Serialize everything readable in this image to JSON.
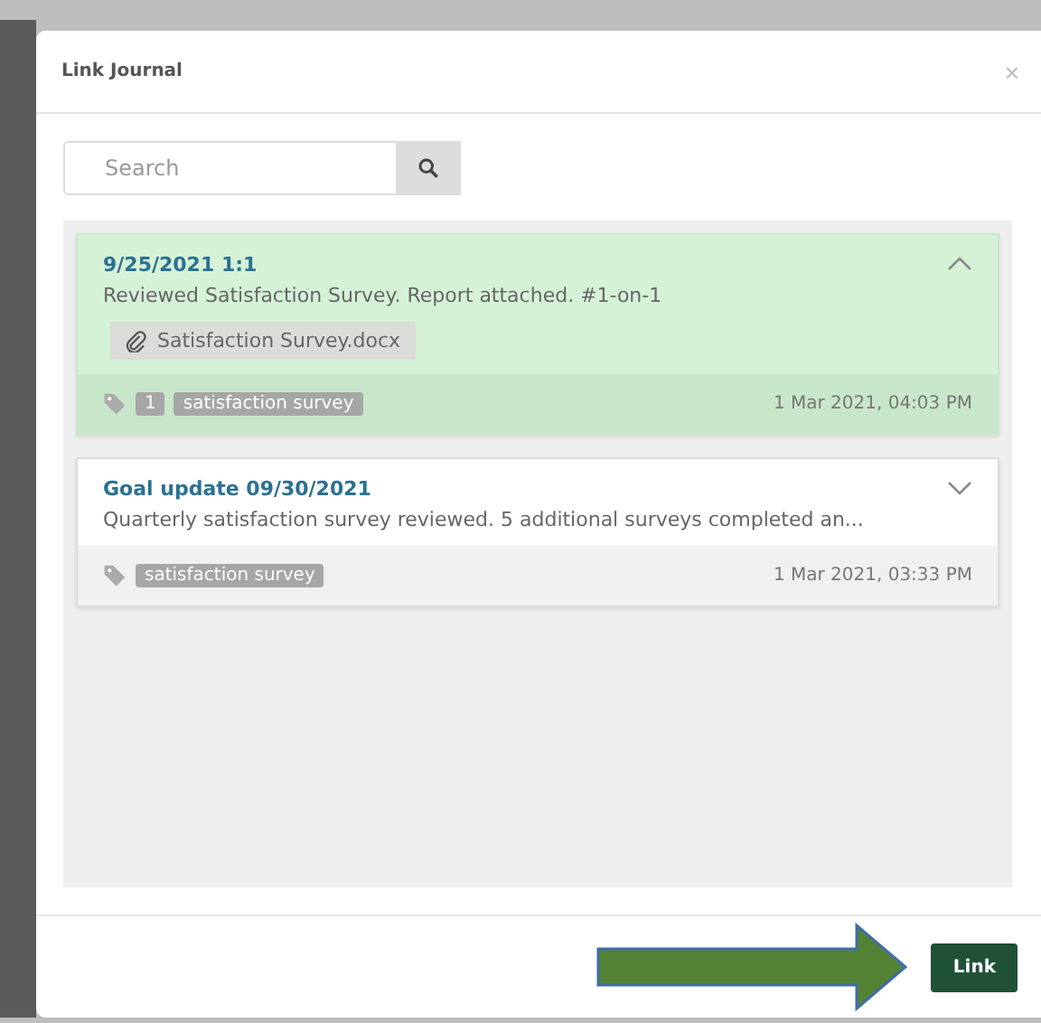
{
  "dialog": {
    "title": "Link Journal",
    "close_label": "×"
  },
  "search": {
    "placeholder": "Search"
  },
  "entries": [
    {
      "title": "9/25/2021 1:1",
      "text": "Reviewed Satisfaction Survey. Report attached. #1-on-1",
      "attachment": "Satisfaction Survey.docx",
      "tags": [
        "1",
        "satisfaction survey"
      ],
      "date": "1 Mar 2021, 04:03 PM",
      "selected": true,
      "expanded": true
    },
    {
      "title": "Goal update 09/30/2021",
      "text": "Quarterly satisfaction survey reviewed. 5 additional surveys completed an...",
      "tags": [
        "satisfaction survey"
      ],
      "date": "1 Mar 2021, 03:33 PM",
      "selected": false,
      "expanded": false
    }
  ],
  "footer": {
    "button": "Link"
  }
}
